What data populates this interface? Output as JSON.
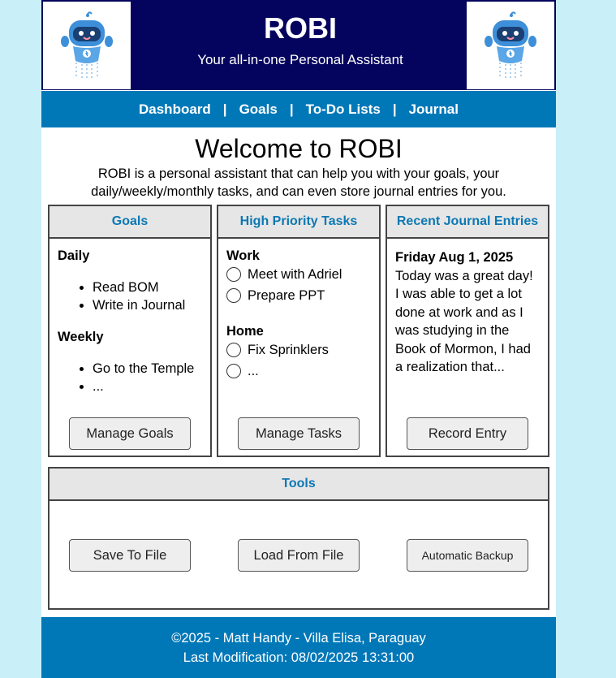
{
  "header": {
    "title": "ROBI",
    "subtitle": "Your all-in-one Personal Assistant",
    "logo_left": "robot-logo",
    "logo_right": "robot-logo"
  },
  "nav": {
    "items": [
      "Dashboard",
      "Goals",
      "To-Do Lists",
      "Journal"
    ],
    "separator": "|"
  },
  "welcome": {
    "title": "Welcome to ROBI",
    "text_line1": "ROBI is a personal assistant that can help you with your goals, your",
    "text_line2": "daily/weekly/monthly tasks, and can even store journal entries for you."
  },
  "goals": {
    "title": "Goals",
    "daily_label": "Daily",
    "daily_items": [
      "Read BOM",
      "Write in Journal"
    ],
    "weekly_label": "Weekly",
    "weekly_items": [
      "Go to the Temple",
      "..."
    ],
    "button": "Manage Goals"
  },
  "tasks": {
    "title": "High Priority Tasks",
    "work_label": "Work",
    "work_items": [
      "Meet with Adriel",
      "Prepare PPT"
    ],
    "home_label": "Home",
    "home_items": [
      "Fix Sprinklers",
      "..."
    ],
    "button": "Manage Tasks"
  },
  "journal": {
    "title": "Recent Journal Entries",
    "date": "Friday Aug 1, 2025",
    "lines": [
      "Today was a great day!",
      "I was able to get a lot",
      "done at work and as I",
      "was studying in the",
      "Book of Mormon, I had",
      "a realization that..."
    ],
    "button": "Record Entry"
  },
  "tools": {
    "title": "Tools",
    "save": "Save To File",
    "load": "Load From File",
    "backup": "Automatic Backup"
  },
  "footer": {
    "copyright": "©2025 - Matt Handy - Villa Elisa, Paraguay",
    "modified": "Last Modification: 08/02/2025 13:31:00"
  },
  "colors": {
    "header_bg": "#04045e",
    "nav_bg": "#0078b8",
    "page_bg": "#c9eff8",
    "card_title": "#0d78b3"
  }
}
